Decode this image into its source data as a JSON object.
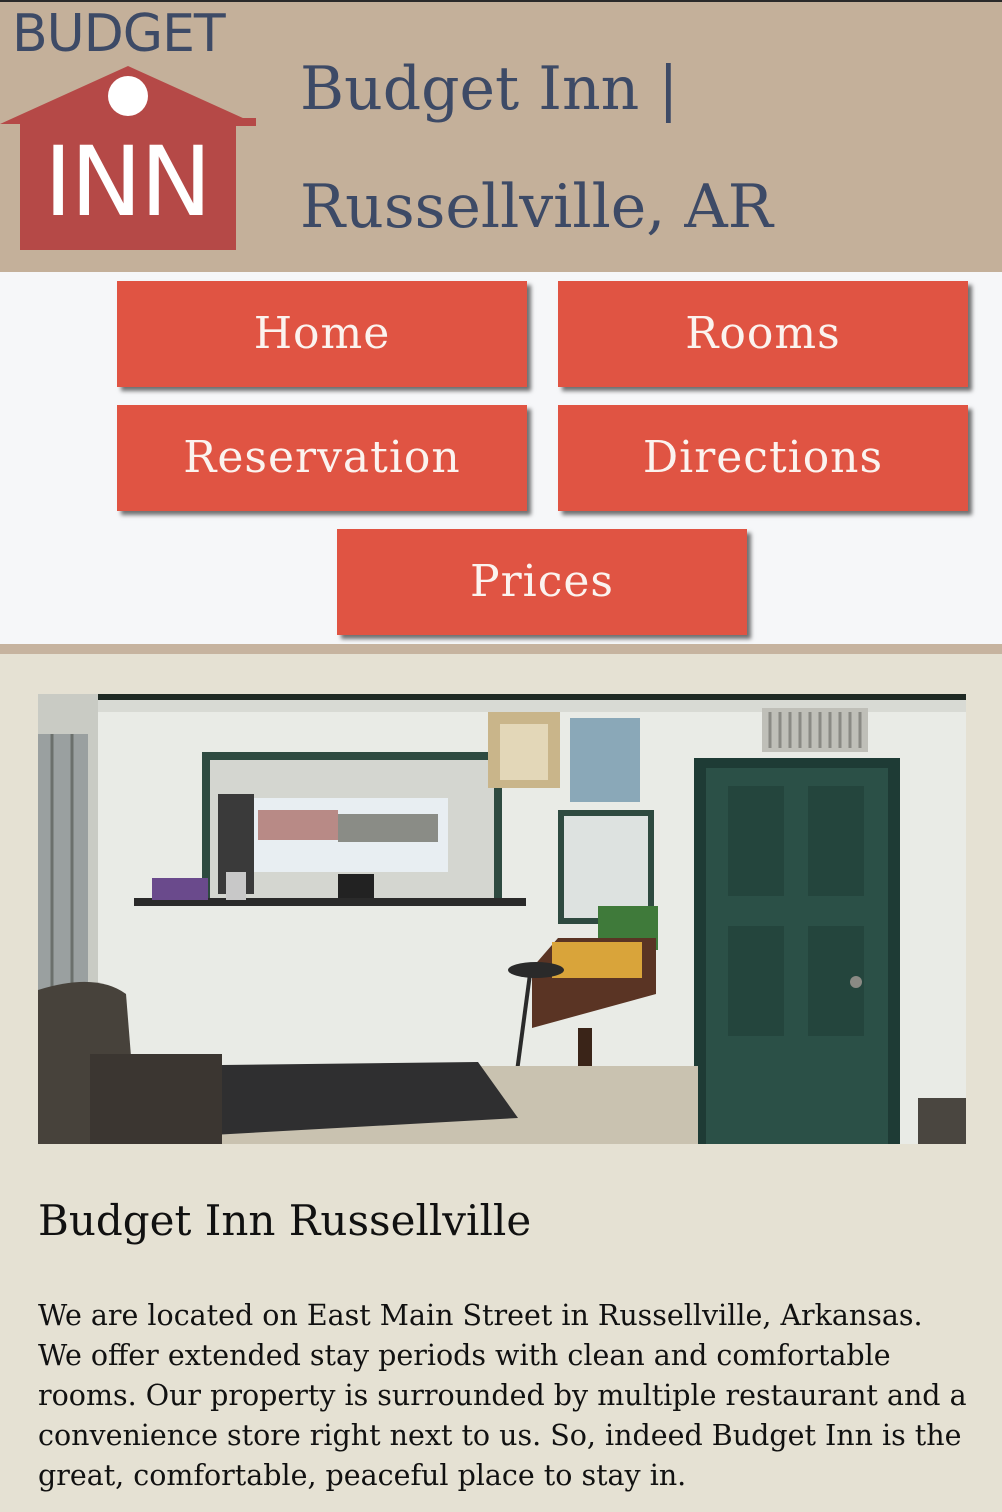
{
  "header": {
    "logo_word": "BUDGET",
    "logo_inn": "INN",
    "title_line1": "Budget Inn |",
    "title_line2": "Russellville, AR"
  },
  "nav": {
    "home": "Home",
    "rooms": "Rooms",
    "reservation": "Reservation",
    "directions": "Directions",
    "prices": "Prices"
  },
  "content": {
    "photo_icon": "lobby-photo",
    "heading": "Budget Inn Russellville",
    "paragraph": "We are located on East Main Street in Russellville, Arkansas. We offer extended stay periods with clean and comfortable rooms. Our property is surrounded by multiple restaurant and a convenience store right next to us. So, indeed Budget Inn is the great, comfortable, peaceful place to stay in."
  },
  "colors": {
    "header_bg": "#c4b09a",
    "button": "#e05443",
    "title_text": "#3d4a66",
    "page_bg": "#e5e1d3"
  }
}
